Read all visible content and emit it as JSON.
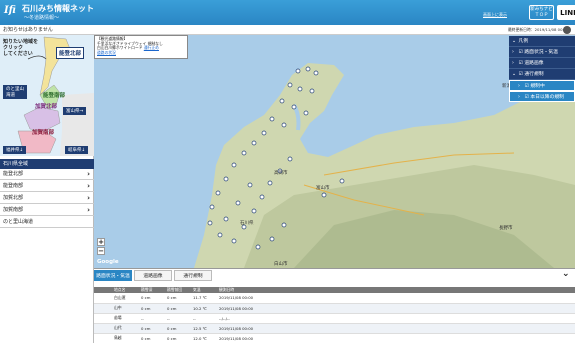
{
  "header": {
    "logo_text": "Ifi",
    "title": "石川みち情報ネット",
    "subtitle": "～冬道路情報～",
    "link": "画面上に表示",
    "top_button": "新みちナビ\nＴＯＰ",
    "line_button": "LINE"
  },
  "notice": {
    "text": "お知らせはありません",
    "updated": "最終更新日時：2019/11/08 00:00"
  },
  "minimap": {
    "hint": "知りたい地域を\nクリック\nしてください",
    "regions": {
      "noto_north": "能登北部",
      "noto_south": "能登南部",
      "noto_hanto": "のと里山\n海道",
      "kaga_north": "加賀北部",
      "kanazawa": "富山県→",
      "kaga_south": "加賀南部",
      "fukui": "福井県↓",
      "gifu": "岐阜県↓"
    }
  },
  "sidebar": {
    "region_header": "石川県全域",
    "items": [
      {
        "label": "能登北部",
        "chevron": "›"
      },
      {
        "label": "能登南部",
        "chevron": "›"
      },
      {
        "label": "加賀北部",
        "chevron": "›"
      },
      {
        "label": "加賀南部",
        "chevron": "›"
      },
      {
        "label": "のと里山海道",
        "chevron": ""
      }
    ]
  },
  "map": {
    "info": {
      "title": "【観光道路情報】",
      "line1": "千里浜なぎさドライブウェイ",
      "line1_status": "規制なし",
      "line2": "白山白川郷ホワイトロード",
      "line2_status": "通行止め",
      "line3": "道路の状況"
    },
    "zoom_in": "+",
    "zoom_out": "−",
    "google": "Google",
    "places": {
      "toyama": "富山市",
      "takaoka": "高岡市",
      "kanazawa": "石川県",
      "nagano": "長野市",
      "niigata": "新潟県",
      "hakusan": "白山市"
    }
  },
  "legend": {
    "header": "凡例",
    "items": [
      {
        "label": "路面状況・気温",
        "checked": true
      },
      {
        "label": "道路画像",
        "checked": true
      },
      {
        "label": "通行規制",
        "checked": true
      },
      {
        "label": "規制中",
        "checked": true
      },
      {
        "label": "本日以降の規制",
        "checked": true
      }
    ]
  },
  "panel": {
    "tabs": [
      "路面状況・気温",
      "道路画像",
      "通行規制"
    ],
    "active_tab": 0,
    "collapse": "⌄",
    "columns": [
      "地点名",
      "積雪深",
      "積雪前回",
      "気温",
      "観測日時"
    ],
    "rows": [
      [
        "白山運",
        "0 cm",
        "0 cm",
        "11.7 ℃",
        "2019/11/08 00:00"
      ],
      [
        "山中",
        "0 cm",
        "0 cm",
        "10.2 ℃",
        "2019/11/08 00:00"
      ],
      [
        "苗場",
        "--",
        "--",
        "--",
        "--/--/--"
      ],
      [
        "山代",
        "0 cm",
        "0 cm",
        "12.5 ℃",
        "2019/11/08 00:00"
      ],
      [
        "鳥越",
        "0 cm",
        "0 cm",
        "12.0 ℃",
        "2019/11/08 00:00"
      ]
    ]
  },
  "colors": {
    "header_blue": "#2a86c4",
    "navy": "#1f3d72",
    "sea": "#a9cce8",
    "land": "#cfd7b0"
  }
}
